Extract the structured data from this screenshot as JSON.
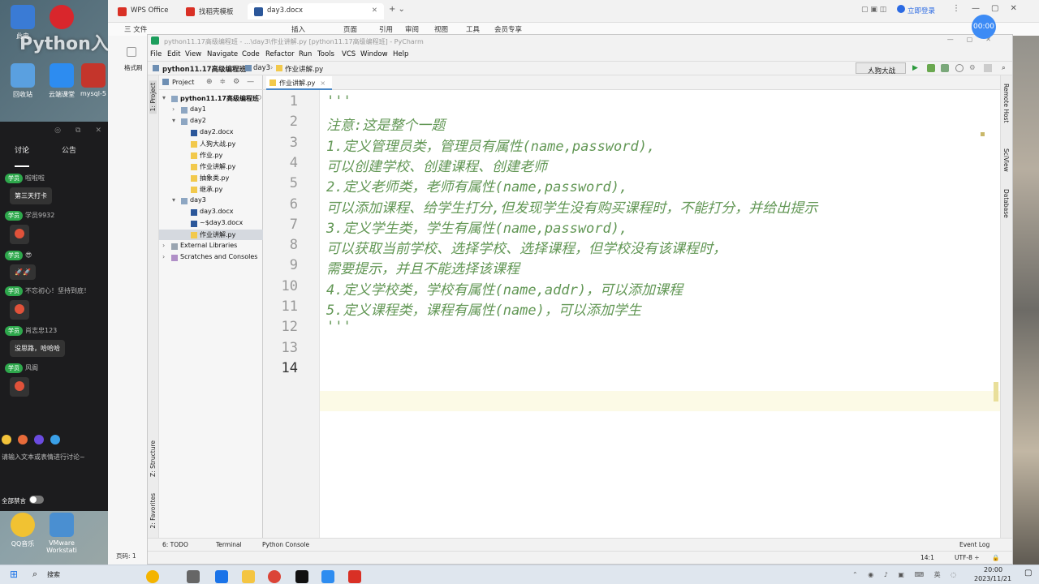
{
  "desktop": {
    "overlay_text": "Python入",
    "icons": [
      {
        "label": "此电",
        "color": "#3a7bd5"
      },
      {
        "label": "回收站",
        "color": "#5aa0e0"
      },
      {
        "label": "云端课堂",
        "color": "#2d8cf0"
      },
      {
        "label": "mysql-5",
        "color": "#c4352b"
      },
      {
        "label": "QQ音乐",
        "color": "#f1c232"
      },
      {
        "label": "VMware Workstati",
        "color": "#4a8fd1"
      }
    ]
  },
  "chat": {
    "tabs": [
      "讨论",
      "公告"
    ],
    "messages": [
      {
        "badge": "学员",
        "user": "啦啦啦",
        "bubble": "第三天打卡",
        "emoji": false
      },
      {
        "badge": "学员",
        "user": "学员9932",
        "bubble": "",
        "emoji": true
      },
      {
        "badge": "学员",
        "user": "😎",
        "bubble": "🚀🚀",
        "emoji": false
      },
      {
        "badge": "学员",
        "user": "不忘初心！坚持到底！",
        "bubble": "",
        "emoji": true
      },
      {
        "badge": "学员",
        "user": "肖志忠123",
        "bubble": "没思路，哈哈哈",
        "emoji": false
      },
      {
        "badge": "学员",
        "user": "风阁",
        "bubble": "",
        "emoji": true
      }
    ],
    "input_placeholder": "请输入文本或表情进行讨论~",
    "mute_all": "全部禁言"
  },
  "wps": {
    "tabs": [
      {
        "label": "WPS Office",
        "color": "#d93025"
      },
      {
        "label": "找稻壳模板",
        "color": "#d93025"
      },
      {
        "label": "day3.docx",
        "color": "#2b579a"
      }
    ],
    "login": "立即登录",
    "menu": [
      "三 文件",
      "插入",
      "页面",
      "引用",
      "审阅",
      "视图",
      "工具",
      "会员专享"
    ],
    "format_brush": "格式刷",
    "page_indicator": "页码: 1",
    "clock": "00:00"
  },
  "pycharm": {
    "title": "python11.17高级编程班 - ...\\day3\\作业讲解.py [python11.17高级编程班] - PyCharm",
    "menu": [
      "File",
      "Edit",
      "View",
      "Navigate",
      "Code",
      "Refactor",
      "Run",
      "Tools",
      "VCS",
      "Window",
      "Help"
    ],
    "breadcrumb": [
      "python11.17高级编程班",
      "day3",
      "作业讲解.py"
    ],
    "run_config": "人狗大战",
    "project_label": "Project",
    "left_tools": [
      "1: Project",
      "Z: Structure",
      "2: Favorites"
    ],
    "right_tools": [
      "Remote Host",
      "SciView",
      "Database"
    ],
    "tree": [
      {
        "label": "python11.17高级编程班",
        "level": 0,
        "arrow": "▾",
        "type": "folder",
        "bold": true,
        "suffix": "D"
      },
      {
        "label": "day1",
        "level": 1,
        "arrow": "›",
        "type": "folder"
      },
      {
        "label": "day2",
        "level": 1,
        "arrow": "▾",
        "type": "folder"
      },
      {
        "label": "day2.docx",
        "level": 2,
        "arrow": "",
        "type": "doc"
      },
      {
        "label": "人狗大战.py",
        "level": 2,
        "arrow": "",
        "type": "py"
      },
      {
        "label": "作业.py",
        "level": 2,
        "arrow": "",
        "type": "py"
      },
      {
        "label": "作业讲解.py",
        "level": 2,
        "arrow": "",
        "type": "py"
      },
      {
        "label": "抽象类.py",
        "level": 2,
        "arrow": "",
        "type": "py"
      },
      {
        "label": "继承.py",
        "level": 2,
        "arrow": "",
        "type": "py"
      },
      {
        "label": "day3",
        "level": 1,
        "arrow": "▾",
        "type": "folder"
      },
      {
        "label": "day3.docx",
        "level": 2,
        "arrow": "",
        "type": "doc"
      },
      {
        "label": "~$day3.docx",
        "level": 2,
        "arrow": "",
        "type": "doc"
      },
      {
        "label": "作业讲解.py",
        "level": 2,
        "arrow": "",
        "type": "py",
        "selected": true
      },
      {
        "label": "External Libraries",
        "level": 0,
        "arrow": "›",
        "type": "lib"
      },
      {
        "label": "Scratches and Consoles",
        "level": 0,
        "arrow": "›",
        "type": "scratch"
      }
    ],
    "editor_tab": "作业讲解.py",
    "code_lines": [
      "'''",
      "注意:这是整个一题",
      "1.定义管理员类，管理员有属性(name,password),",
      "可以创建学校、创建课程、创建老师",
      "2.定义老师类，老师有属性(name,password),",
      "可以添加课程、给学生打分,但发现学生没有购买课程时，不能打分，并给出提示",
      "3.定义学生类，学生有属性(name,password),",
      "可以获取当前学校、选择学校、选择课程，但学校没有该课程时，",
      "需要提示，并且不能选择该课程",
      "4.定义学校类，学校有属性(name,addr)，可以添加课程",
      "5.定义课程类，课程有属性(name)，可以添加学生",
      "'''",
      "",
      ""
    ],
    "current_line": 14,
    "bottom_tabs": [
      "6: TODO",
      "Terminal",
      "Python Console"
    ],
    "event_log": "Event Log",
    "status": {
      "position": "14:1",
      "encoding": "UTF-8 ÷"
    }
  },
  "taskbar": {
    "search": "搜索",
    "time": "20:00",
    "date": "2023/11/21"
  }
}
